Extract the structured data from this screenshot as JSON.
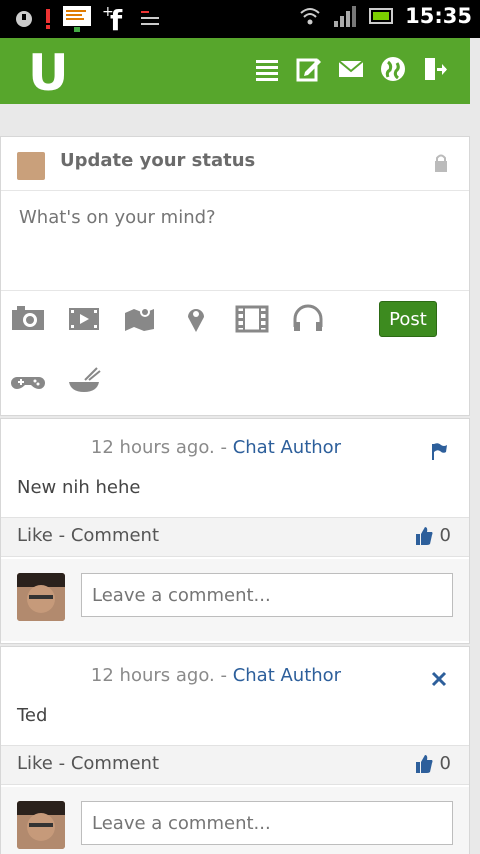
{
  "statusbar": {
    "time": "15:35",
    "icons": [
      "silent-icon",
      "alert-icon",
      "notes-icon",
      "facebook-icon",
      "tasks-icon",
      "wifi-icon",
      "signal-icon",
      "battery-icon"
    ]
  },
  "app": {
    "logo": "U",
    "nav": [
      "menu-icon",
      "compose-icon",
      "mail-icon",
      "globe-icon",
      "logout-icon"
    ],
    "accent": "#57a62c"
  },
  "status": {
    "title": "Update your status",
    "placeholder": "What's on your mind?",
    "post_label": "Post",
    "tools": [
      "camera-icon",
      "video-icon",
      "map-icon",
      "location-icon",
      "film-icon",
      "headphones-icon",
      "gamepad-icon",
      "food-icon"
    ]
  },
  "feed": {
    "items": [
      {
        "time": "12 hours ago",
        "sep": ". - ",
        "author": "Chat Author",
        "text": "New nih hehe",
        "actions": "Like - Comment",
        "likes": "0",
        "comment_placeholder": "Leave a comment..."
      },
      {
        "time": "12 hours ago",
        "sep": ". - ",
        "author": "Chat Author",
        "text": "Ted",
        "actions": "Like - Comment",
        "likes": "0",
        "comment_placeholder": "Leave a comment..."
      }
    ]
  }
}
